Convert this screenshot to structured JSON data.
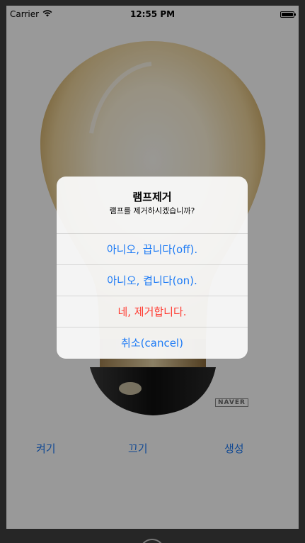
{
  "status_bar": {
    "carrier": "Carrier",
    "time": "12:55 PM"
  },
  "main": {
    "buttons": {
      "on_label": "켜기",
      "off_label": "끄기",
      "create_label": "생성"
    },
    "watermark": "NAVER"
  },
  "alert": {
    "title": "램프제거",
    "message": "램프를 제거하시겠습니까?",
    "actions": [
      {
        "label": "아니오, 끕니다(off)."
      },
      {
        "label": "아니오, 켭니다(on)."
      },
      {
        "label": "네, 제거합니다."
      },
      {
        "label": "취소(cancel)"
      }
    ]
  },
  "colors": {
    "accent": "#1e7bf5",
    "destructive": "#ff3b30"
  }
}
